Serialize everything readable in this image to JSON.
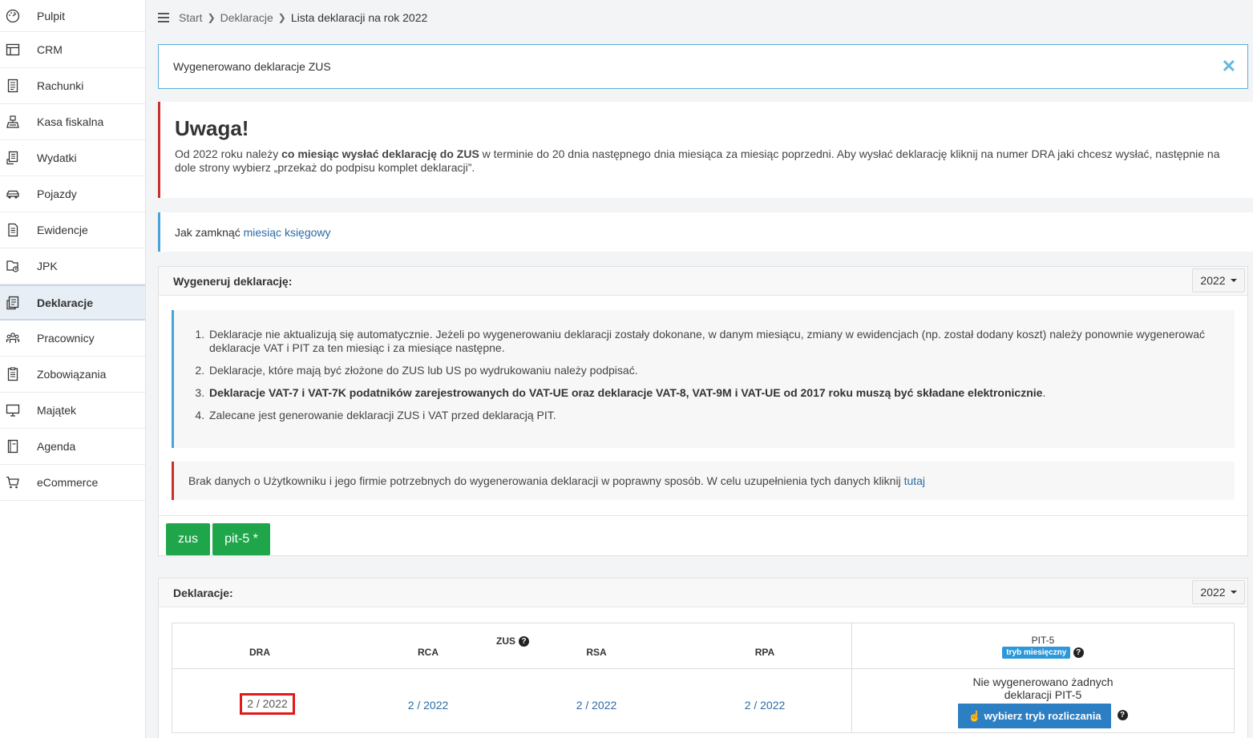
{
  "sidebar": {
    "items": [
      {
        "label": "Pulpit",
        "icon": "dashboard-icon"
      },
      {
        "label": "CRM",
        "icon": "table-icon"
      },
      {
        "label": "Rachunki",
        "icon": "receipt-icon"
      },
      {
        "label": "Kasa fiskalna",
        "icon": "cash-register-icon"
      },
      {
        "label": "Wydatki",
        "icon": "expense-icon"
      },
      {
        "label": "Pojazdy",
        "icon": "car-icon"
      },
      {
        "label": "Ewidencje",
        "icon": "ledger-icon"
      },
      {
        "label": "JPK",
        "icon": "jpk-icon"
      },
      {
        "label": "Deklaracje",
        "icon": "declaration-icon"
      },
      {
        "label": "Pracownicy",
        "icon": "employees-icon"
      },
      {
        "label": "Zobowiązania",
        "icon": "liabilities-icon"
      },
      {
        "label": "Majątek",
        "icon": "monitor-icon"
      },
      {
        "label": "Agenda",
        "icon": "agenda-icon"
      },
      {
        "label": "eCommerce",
        "icon": "cart-icon"
      }
    ],
    "active": "Deklaracje"
  },
  "breadcrumb": {
    "items": [
      "Start",
      "Deklaracje",
      "Lista deklaracji na rok 2022"
    ]
  },
  "flash": {
    "message": "Wygenerowano deklaracje ZUS",
    "close": "✕"
  },
  "warning": {
    "title": "Uwaga!",
    "text_before": "Od 2022 roku należy ",
    "text_bold": "co miesiąc wysłać deklarację do ZUS",
    "text_after": " w terminie do 20 dnia następnego dnia miesiąca za miesiąc poprzedni. Aby wysłać deklarację kliknij na numer DRA jaki chcesz wysłać, następnie na dole strony wybierz „przekaż do podpisu komplet deklaracji”."
  },
  "info": {
    "text": "Jak zamknąć ",
    "link": "miesiąc księgowy"
  },
  "generate_panel": {
    "title": "Wygeneruj deklarację:",
    "year": "2022",
    "notes": [
      "Deklaracje nie aktualizują się automatycznie. Jeżeli po wygenerowaniu deklaracji zostały dokonane, w danym miesiącu, zmiany w ewidencjach (np. został dodany koszt) należy ponownie wygenerować deklaracje VAT i PIT za ten miesiąc i za miesiące następne.",
      "Deklaracje, które mają być złożone do ZUS lub US po wydrukowaniu należy podpisać.",
      "Deklaracje VAT-7 i VAT-7K podatników zarejestrowanych do VAT-UE oraz deklaracje VAT-8, VAT-9M i VAT-UE od 2017 roku muszą być składane elektronicznie",
      "Zalecane jest generowanie deklaracji ZUS i VAT przed deklaracją PIT."
    ],
    "note3_suffix": ".",
    "nodata_text": "Brak danych o Użytkowniku i jego firmie potrzebnych do wygenerowania deklaracji w poprawny sposób. W celu uzupełnienia tych danych kliknij ",
    "nodata_link": "tutaj",
    "buttons": [
      "zus",
      "pit-5 *"
    ]
  },
  "declarations_panel": {
    "title": "Deklaracje:",
    "year": "2022",
    "zus_label": "ZUS",
    "columns": [
      "DRA",
      "RCA",
      "RSA",
      "RPA"
    ],
    "values": [
      "2 / 2022",
      "2 / 2022",
      "2 / 2022",
      "2 / 2022"
    ],
    "pit_title": "PIT-5",
    "pit_badge": "tryb miesięczny",
    "pit_message_line1": "Nie wygenerowano żadnych",
    "pit_message_line2": "deklaracji PIT-5",
    "pit_button": "wybierz tryb rozliczania",
    "help": "?"
  }
}
